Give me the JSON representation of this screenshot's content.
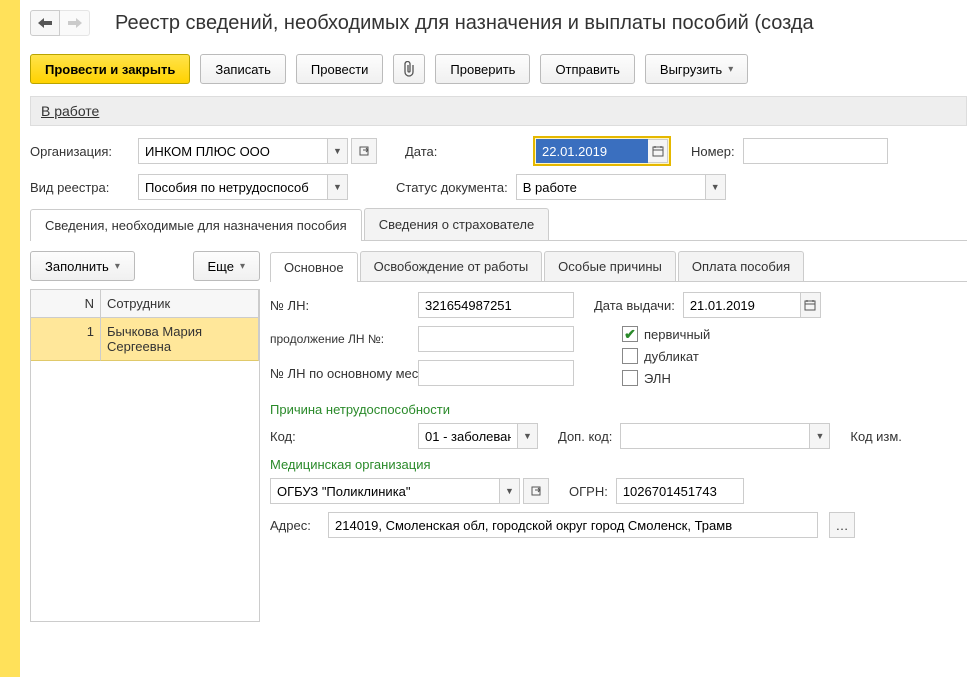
{
  "page_title": "Реестр сведений, необходимых для назначения и выплаты пособий (созда",
  "toolbar": {
    "primary": "Провести и закрыть",
    "save": "Записать",
    "post": "Провести",
    "check": "Проверить",
    "send": "Отправить",
    "export": "Выгрузить"
  },
  "status_text": "В работе",
  "fields": {
    "org_label": "Организация:",
    "org_value": "ИНКОМ ПЛЮС ООО",
    "date_label": "Дата:",
    "date_value": "22.01.2019",
    "number_label": "Номер:",
    "number_value": "",
    "registry_type_label": "Вид реестра:",
    "registry_type_value": "Пособия по нетрудоспособ",
    "doc_status_label": "Статус документа:",
    "doc_status_value": "В работе"
  },
  "main_tabs": [
    "Сведения, необходимые для назначения пособия",
    "Сведения о страхователе"
  ],
  "left": {
    "fill": "Заполнить",
    "more": "Еще",
    "table_headers": [
      "N",
      "Сотрудник"
    ],
    "row": {
      "n": "1",
      "name": "Бычкова Мария Сергеевна"
    }
  },
  "inner_tabs": [
    "Основное",
    "Освобождение от работы",
    "Особые причины",
    "Оплата пособия"
  ],
  "details": {
    "ln_label": "№ ЛН:",
    "ln_value": "321654987251",
    "issue_date_label": "Дата выдачи:",
    "issue_date_value": "21.01.2019",
    "cont_label": "продолжение ЛН №:",
    "cont_value": "",
    "main_place_label": "№ ЛН по основному месту работы:",
    "main_place_value": "",
    "cb_primary": "первичный",
    "cb_duplicate": "дубликат",
    "cb_eln": "ЭЛН",
    "reason_section": "Причина нетрудоспособности",
    "code_label": "Код:",
    "code_value": "01 - заболеван",
    "add_code_label": "Доп. код:",
    "add_code_value": "",
    "change_code_label": "Код изм.",
    "med_section": "Медицинская организация",
    "med_value": "ОГБУЗ \"Поликлиника\"",
    "ogrn_label": "ОГРН:",
    "ogrn_value": "1026701451743",
    "addr_label": "Адрес:",
    "addr_value": "214019, Смоленская обл, городской округ город Смоленск, Трамв"
  }
}
